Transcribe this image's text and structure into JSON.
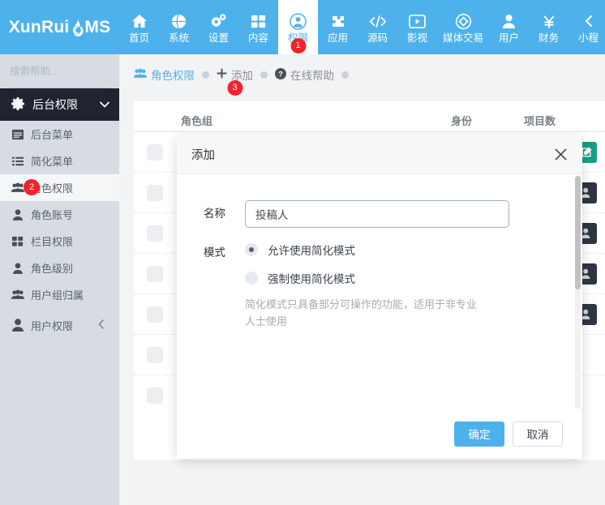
{
  "brand": {
    "text_before": "XunRui",
    "flame": "flame-c-icon",
    "text_after": "MS",
    "accent": "#4db2ec"
  },
  "topnav": {
    "items": [
      {
        "label": "首页",
        "icon": "home-icon",
        "active": false,
        "badge": ""
      },
      {
        "label": "系统",
        "icon": "globe-icon",
        "active": false,
        "badge": ""
      },
      {
        "label": "设置",
        "icon": "gears-icon",
        "active": false,
        "badge": ""
      },
      {
        "label": "内容",
        "icon": "grid-icon",
        "active": false,
        "badge": ""
      },
      {
        "label": "权限",
        "icon": "user-circle-icon",
        "active": true,
        "badge": "1"
      },
      {
        "label": "应用",
        "icon": "puzzle-icon",
        "active": false,
        "badge": ""
      },
      {
        "label": "源码",
        "icon": "code-icon",
        "active": false,
        "badge": ""
      },
      {
        "label": "影视",
        "icon": "video-icon",
        "active": false,
        "badge": ""
      },
      {
        "label": "媒体交易",
        "icon": "diamond-icon",
        "active": false,
        "badge": ""
      },
      {
        "label": "用户",
        "icon": "user-icon",
        "active": false,
        "badge": ""
      },
      {
        "label": "财务",
        "icon": "yen-icon",
        "active": false,
        "badge": ""
      },
      {
        "label": "小程",
        "icon": "chevron-icon",
        "active": false,
        "badge": ""
      }
    ]
  },
  "sidebar": {
    "search_placeholder": "搜索帮助...",
    "search_value": "",
    "search_icon": "search-icon",
    "group": {
      "label": "后台权限",
      "icon": "gear-icon",
      "chevron": "chevron-down-icon"
    },
    "items": [
      {
        "label": "后台菜单",
        "icon": "window-icon",
        "selected": false,
        "badge": "",
        "chevron": ""
      },
      {
        "label": "简化菜单",
        "icon": "list-icon",
        "selected": false,
        "badge": "",
        "chevron": ""
      },
      {
        "label": "角色权限",
        "icon": "users-icon",
        "selected": true,
        "badge": "2",
        "chevron": ""
      },
      {
        "label": "角色账号",
        "icon": "user-icon",
        "selected": false,
        "badge": "",
        "chevron": ""
      },
      {
        "label": "栏目权限",
        "icon": "grid-icon",
        "selected": false,
        "badge": "",
        "chevron": ""
      },
      {
        "label": "角色级别",
        "icon": "user-icon",
        "selected": false,
        "badge": "",
        "chevron": ""
      },
      {
        "label": "用户组归属",
        "icon": "users-icon",
        "selected": false,
        "badge": "",
        "chevron": ""
      },
      {
        "label": "用户权限",
        "icon": "user-solid-icon",
        "selected": false,
        "badge": "",
        "chevron": "chevron-left-icon"
      }
    ]
  },
  "breadcrumb": {
    "items": [
      {
        "label": "角色权限",
        "icon": "users-icon",
        "state": "active",
        "badge": ""
      },
      {
        "label": "添加",
        "icon": "plus-icon",
        "state": "muted",
        "badge": "3"
      },
      {
        "label": "在线帮助",
        "icon": "help-icon",
        "state": "muted",
        "badge": ""
      }
    ]
  },
  "table": {
    "headers": [
      "",
      "角色组",
      "身份",
      "项目数"
    ],
    "rows": [
      {
        "checkbox": "",
        "action_icon": "edit-icon",
        "action_style": "teal"
      },
      {
        "checkbox": "",
        "action_icon": "user-add-icon",
        "action_style": "dark"
      },
      {
        "checkbox": "",
        "action_icon": "user-add-icon",
        "action_style": "dark"
      },
      {
        "checkbox": "",
        "action_icon": "user-add-icon",
        "action_style": "dark"
      },
      {
        "checkbox": "",
        "action_icon": "user-add-icon",
        "action_style": "dark"
      },
      {
        "checkbox": "",
        "action_icon": "",
        "action_style": ""
      },
      {
        "checkbox": "",
        "action_icon": "",
        "action_style": ""
      }
    ]
  },
  "modal": {
    "title": "添加",
    "close_icon": "close-icon",
    "name_label": "名称",
    "name_value": "投稿人",
    "name_placeholder": "",
    "mode_label": "模式",
    "options": [
      {
        "label": "允许使用简化模式",
        "checked": true
      },
      {
        "label": "强制使用简化模式",
        "checked": false
      }
    ],
    "hint": "简化模式只具备部分可操作的功能，适用于非专业人士使用",
    "confirm_label": "确定",
    "cancel_label": "取消"
  }
}
